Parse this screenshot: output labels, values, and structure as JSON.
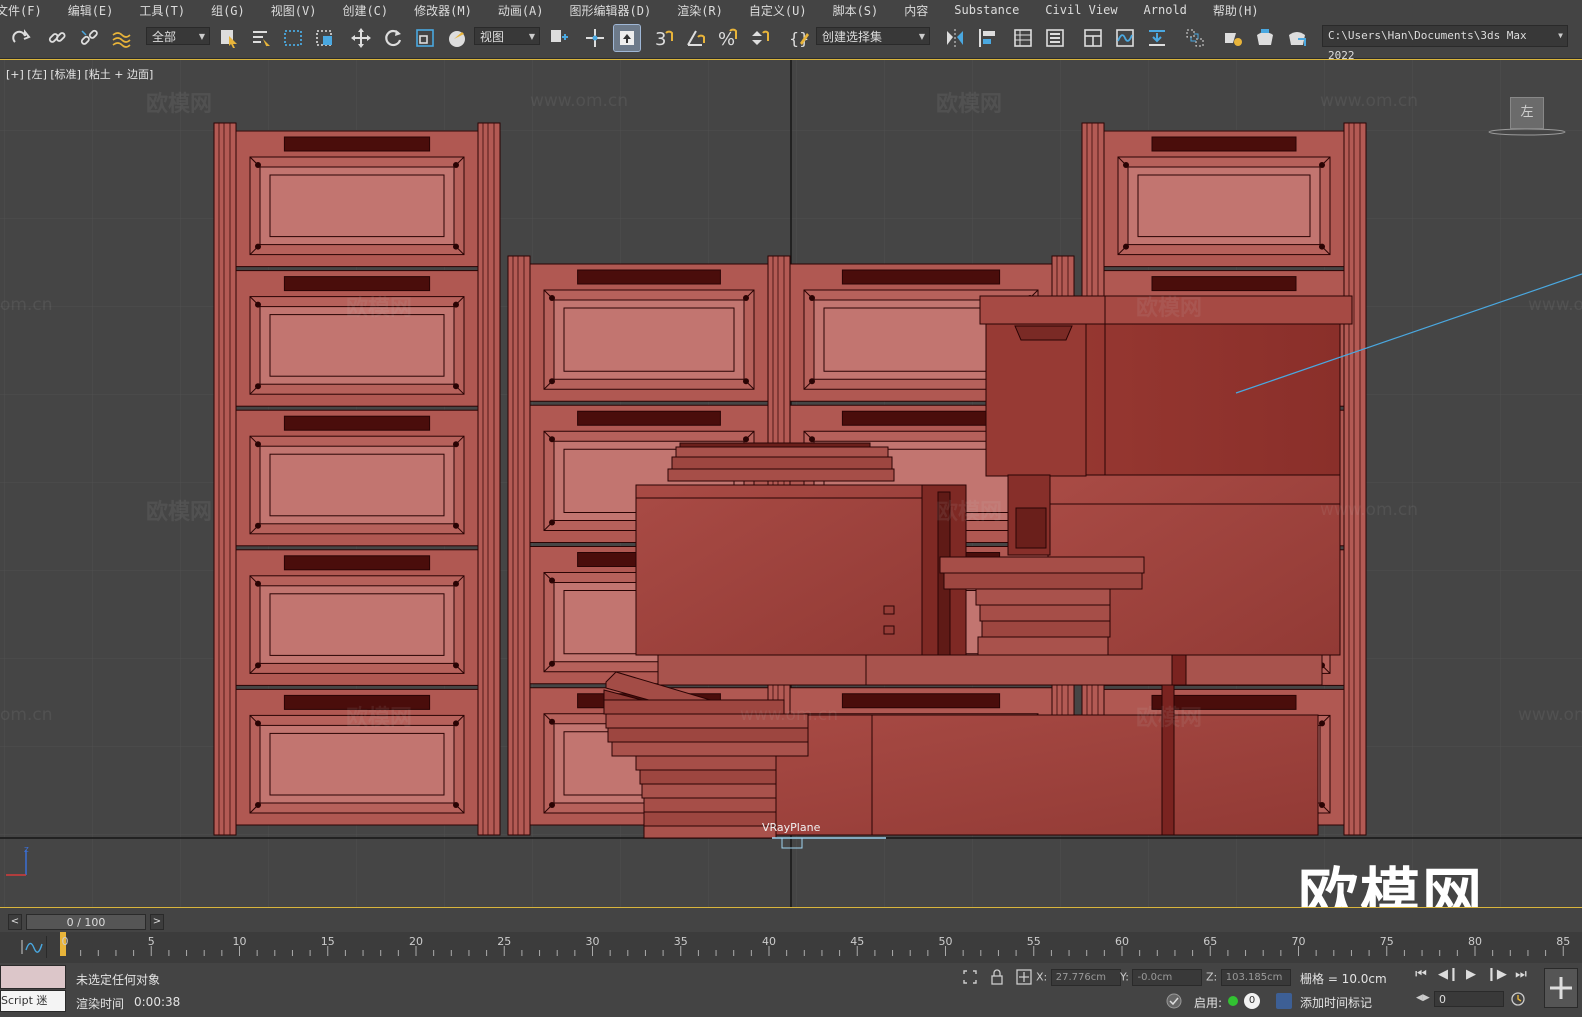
{
  "menu": [
    "文件(F)",
    "编辑(E)",
    "工具(T)",
    "组(G)",
    "视图(V)",
    "创建(C)",
    "修改器(M)",
    "动画(A)",
    "图形编辑器(D)",
    "渲染(R)",
    "自定义(U)",
    "脚本(S)",
    "内容",
    "Substance",
    "Civil View",
    "Arnold",
    "帮助(H)"
  ],
  "toolbar": {
    "filter_selected": "全部",
    "ref_coord_selected": "视图",
    "named_selection_selected": "创建选择集",
    "project_path": "C:\\Users\\Han\\Documents\\3ds Max 2022"
  },
  "icons": {
    "redo": "redo-icon",
    "link": "link-icon",
    "unlink": "unlink-icon",
    "bind": "bind-space-warp-icon",
    "select": "select-object-icon",
    "select_by_name": "select-by-name-icon",
    "rect_region": "rectangular-region-icon",
    "window_crossing": "window-crossing-icon",
    "move": "move-icon",
    "rotate": "rotate-icon",
    "scale": "scale-icon",
    "place": "place-icon",
    "pivot": "pivot-center-icon",
    "manipulate": "manipulate-icon",
    "keyboard_shortcut": "keyboard-shortcut-toggle-icon",
    "snap3": "snap-3d-icon",
    "angle_snap": "angle-snap-icon",
    "percent_snap": "percent-snap-icon",
    "spinner_snap": "spinner-snap-icon",
    "edit_named_sel": "edit-named-selection-icon",
    "mirror": "mirror-icon",
    "align": "align-icon",
    "layer_explorer": "layer-explorer-icon",
    "toggle_ribbon": "toggle-ribbon-icon",
    "scene_explorer": "scene-explorer-icon",
    "curve_editor": "curve-editor-icon",
    "schematic": "schematic-view-icon",
    "material_editor": "material-editor-icon",
    "render_setup": "render-setup-icon",
    "render_frame": "rendered-frame-window-icon",
    "render": "render-production-icon",
    "path_dropdown": "chevron-down-icon"
  },
  "viewport": {
    "label": "[+] [左] [标准] [粘土 + 边面]",
    "nav_cube": "左",
    "object_label": "VRayPlane",
    "axis_z": "z",
    "watermark_cn": "欧模网",
    "watermark_url": "www.om.cn",
    "watermark_url_cropped": "om.cn",
    "logo": "欧模网"
  },
  "timeline": {
    "frame_display": "0 / 100",
    "prev_label": "<",
    "next_label": ">",
    "ticks": [
      "0",
      "5",
      "10",
      "15",
      "20",
      "25",
      "30",
      "35",
      "40",
      "45",
      "50",
      "55",
      "60",
      "65",
      "70",
      "75",
      "80",
      "85"
    ]
  },
  "status": {
    "script_label": "Script 迷",
    "selection": "未选定任何对象",
    "render_time_label": "渲染时间",
    "render_time": "0:00:38",
    "x_label": "X:",
    "x": "27.776cm",
    "y_label": "Y:",
    "y": "-0.0cm",
    "z_label": "Z:",
    "z": "103.185cm",
    "grid": "栅格 = 10.0cm",
    "enable_label": "启用:",
    "enable_count": "0",
    "add_time_tag": "添加时间标记",
    "current_frame": "0"
  },
  "colors": {
    "ui_bg": "#444444",
    "viewport_bg": "#454545",
    "grid": "#505050",
    "clay": "#b85d59",
    "clay_dark": "#8a3329",
    "edge": "#2a0404",
    "active_border": "#d9b53c",
    "accent_blue": "#4aa8e0"
  }
}
